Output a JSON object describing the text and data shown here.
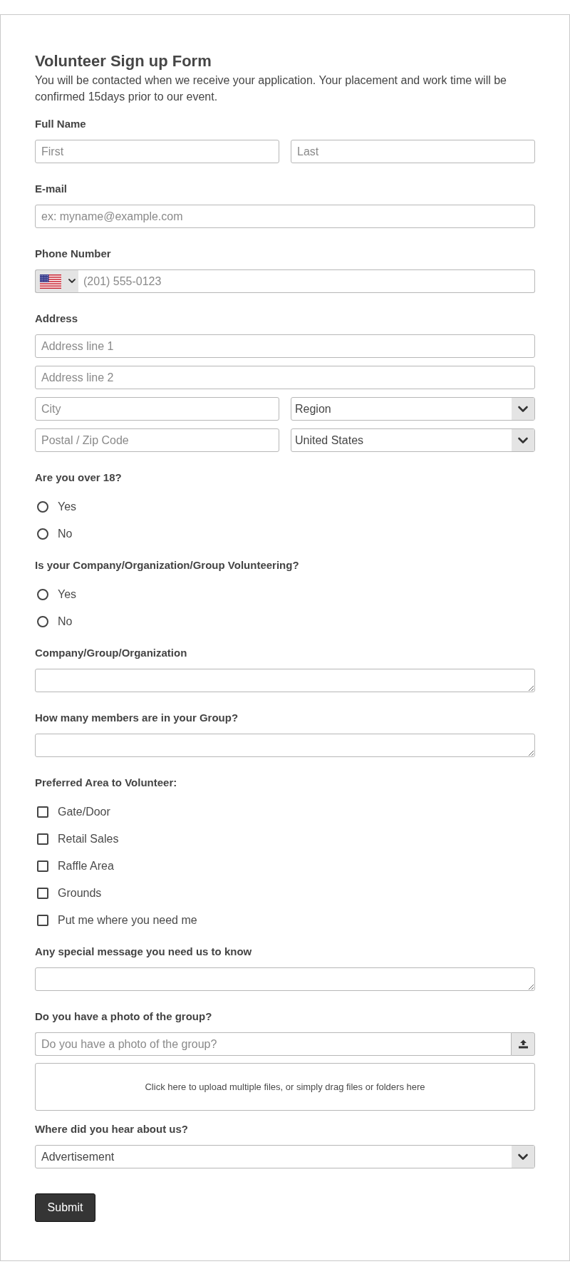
{
  "form": {
    "title": "Volunteer Sign up Form",
    "description": "You will be contacted when we receive your application. Your placement and work time will be confirmed 15days prior to our event."
  },
  "fields": [
    {
      "kind": "name",
      "label": "Full Name",
      "inputs": [
        {
          "placeholder": "First"
        },
        {
          "placeholder": "Last"
        }
      ]
    },
    {
      "kind": "text",
      "label": "E-mail",
      "placeholder": "ex: myname@example.com"
    },
    {
      "kind": "phone",
      "label": "Phone Number",
      "placeholder": "(201) 555-0123"
    },
    {
      "kind": "address",
      "label": "Address",
      "lines": [
        {
          "placeholder": "Address line 1"
        },
        {
          "placeholder": "Address line 2"
        }
      ],
      "grid": [
        {
          "kind": "text",
          "placeholder": "City"
        },
        {
          "kind": "select",
          "value": "Region"
        },
        {
          "kind": "text",
          "placeholder": "Postal / Zip Code"
        },
        {
          "kind": "select",
          "value": "United States"
        }
      ]
    },
    {
      "kind": "radio",
      "label": "Are you over 18?",
      "options": [
        {
          "label": "Yes",
          "selected": false
        },
        {
          "label": "No",
          "selected": false
        }
      ]
    },
    {
      "kind": "radio",
      "label": "Is your Company/Organization/Group Volunteering?",
      "options": [
        {
          "label": "Yes",
          "selected": false
        },
        {
          "label": "No",
          "selected": false
        }
      ]
    },
    {
      "kind": "textarea",
      "label": "Company/Group/Organization"
    },
    {
      "kind": "textarea",
      "label": "How many members are in your Group?"
    },
    {
      "kind": "checkbox",
      "label": "Preferred Area to Volunteer:",
      "options": [
        {
          "label": "Gate/Door",
          "checked": false
        },
        {
          "label": "Retail Sales",
          "checked": false
        },
        {
          "label": "Raffle Area",
          "checked": false
        },
        {
          "label": "Grounds",
          "checked": false
        },
        {
          "label": "Put me where you need me",
          "checked": false
        }
      ]
    },
    {
      "kind": "textarea",
      "label": "Any special message you need us to know"
    },
    {
      "kind": "file",
      "label": "Do you have a photo of the group?",
      "placeholder": "Do you have a photo of the group?",
      "dropzone": "Click here to upload multiple files, or simply drag files or folders here"
    },
    {
      "kind": "select",
      "label": "Where did you hear about us?",
      "value": "Advertisement"
    }
  ],
  "submit": {
    "label": "Submit"
  }
}
